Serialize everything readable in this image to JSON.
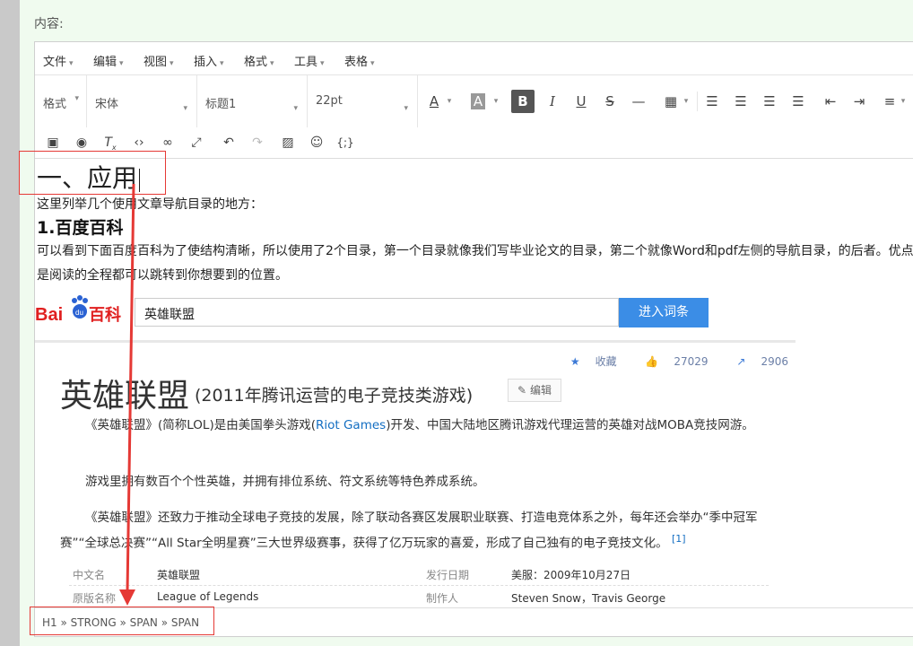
{
  "content_label": "内容:",
  "menubar": [
    "文件",
    "编辑",
    "视图",
    "插入",
    "格式",
    "工具",
    "表格"
  ],
  "toolbar": {
    "format_label": "格式",
    "font_family": "宋体",
    "heading": "标题1",
    "font_size": "22pt"
  },
  "doc": {
    "h1": "一、应用",
    "intro": "这里列举几个使用文章导航目录的地方：",
    "h2": "1.百度百科",
    "para": "可以看到下面百度百科为了使结构清晰，所以使用了2个目录，第一个目录就像我们写毕业论文的目录，第二个就像Word和pdf左侧的导航目录，的后者。优点就是阅读的全程都可以跳转到你想要到的位置。"
  },
  "baidu": {
    "search_value": "英雄联盟",
    "search_button": "进入词条",
    "actions": {
      "collect": "收藏",
      "likes": "27029",
      "shares": "2906"
    },
    "title": "英雄联盟",
    "subtitle": "(2011年腾讯运营的电子竞技类游戏)",
    "edit": "编辑",
    "p1_a": "《英雄联盟》(简称LOL)是由美国拳头游戏(",
    "p1_link": "Riot Games",
    "p1_b": ")开发、中国大陆地区腾讯游戏代理运营的英雄对战MOBA竞技网游。",
    "p2": "游戏里拥有数百个个性英雄，并拥有排位系统、符文系统等特色养成系统。",
    "p3": "《英雄联盟》还致力于推动全球电子竞技的发展，除了联动各赛区发展职业联赛、打造电竞体系之外，每年还会举办“季中冠军赛”“全球总决赛”“All Star全明星赛”三大世界级赛事，获得了亿万玩家的喜爱，形成了自己独有的电子竞技文化。",
    "p3_ref": "[1]",
    "info": [
      {
        "k1": "中文名",
        "v1": "英雄联盟",
        "k2": "发行日期",
        "v2": "美服：2009年10月27日"
      },
      {
        "k1": "原版名称",
        "v1": "League of Legends",
        "k2": "制作人",
        "v2": "Steven Snow，Travis George"
      }
    ]
  },
  "status_path": "H1 » STRONG » SPAN » SPAN",
  "colors": {
    "accent": "#3b8de6",
    "annotation": "#e53935",
    "page_bg": "#f0fbef"
  }
}
